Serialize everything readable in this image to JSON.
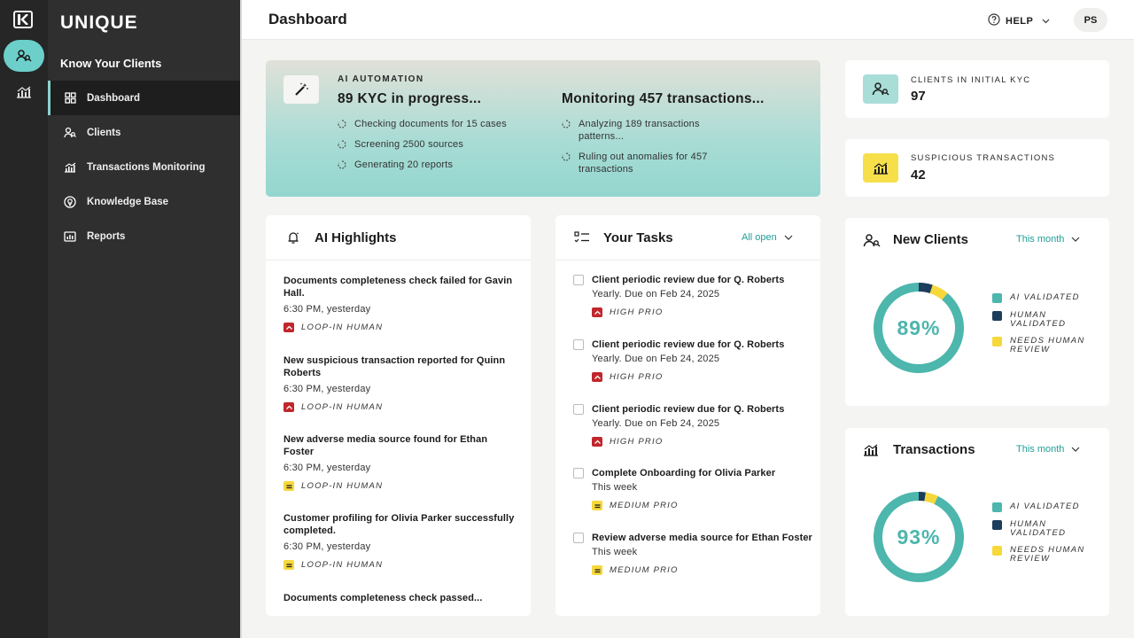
{
  "app": {
    "brand": "UNIQUE",
    "section": "Know Your Clients"
  },
  "sidebar": {
    "items": [
      {
        "label": "Dashboard",
        "icon": "dashboard-icon",
        "active": true
      },
      {
        "label": "Clients",
        "icon": "clients-icon"
      },
      {
        "label": "Transactions Monitoring",
        "icon": "transactions-icon"
      },
      {
        "label": "Knowledge Base",
        "icon": "knowledge-icon"
      },
      {
        "label": "Reports",
        "icon": "reports-icon"
      }
    ]
  },
  "header": {
    "title": "Dashboard",
    "help": "HELP",
    "avatar": "PS"
  },
  "automation": {
    "kicker": "AI AUTOMATION",
    "kyc_title": "89 KYC in progress...",
    "kyc_items": [
      "Checking documents for 15 cases",
      "Screening 2500 sources",
      "Generating 20 reports"
    ],
    "tx_title": "Monitoring 457 transactions...",
    "tx_items": [
      "Analyzing 189 transactions patterns...",
      "Ruling out anomalies for 457 transactions"
    ]
  },
  "stats": {
    "initial_kyc": {
      "label": "CLIENTS IN INITIAL KYC",
      "value": "97"
    },
    "suspicious": {
      "label": "SUSPICIOUS TRANSACTIONS",
      "value": "42"
    }
  },
  "highlights": {
    "title": "AI Highlights",
    "items": [
      {
        "text": "Documents completeness check failed for Gavin Hall.",
        "time": "6:30 PM, yesterday",
        "tag": "LOOP-IN HUMAN",
        "level": "high"
      },
      {
        "text": "New suspicious transaction reported for Quinn Roberts",
        "time": "6:30 PM, yesterday",
        "tag": "LOOP-IN HUMAN",
        "level": "high"
      },
      {
        "text": "New adverse media source found for Ethan Foster",
        "time": "6:30 PM, yesterday",
        "tag": "LOOP-IN HUMAN",
        "level": "medium"
      },
      {
        "text": "Customer profiling for Olivia Parker successfully completed.",
        "time": "6:30 PM, yesterday",
        "tag": "LOOP-IN HUMAN",
        "level": "medium"
      },
      {
        "text": "Documents completeness check passed..."
      }
    ]
  },
  "tasks": {
    "title": "Your Tasks",
    "filter": "All open",
    "items": [
      {
        "title": "Client periodic review due for Q. Roberts",
        "sub": "Yearly. Due on Feb 24, 2025",
        "tag": "HIGH PRIO",
        "level": "high"
      },
      {
        "title": "Client periodic review due for Q. Roberts",
        "sub": "Yearly. Due on Feb 24, 2025",
        "tag": "HIGH PRIO",
        "level": "high"
      },
      {
        "title": "Client periodic review due for Q. Roberts",
        "sub": "Yearly. Due on Feb 24, 2025",
        "tag": "HIGH PRIO",
        "level": "high"
      },
      {
        "title": "Complete Onboarding for Olivia Parker",
        "sub": "This week",
        "tag": "MEDIUM PRIO",
        "level": "medium"
      },
      {
        "title": "Review adverse media source for Ethan Foster",
        "sub": "This week",
        "tag": "MEDIUM PRIO",
        "level": "medium"
      }
    ]
  },
  "new_clients": {
    "title": "New Clients",
    "filter": "This month",
    "center": "89%",
    "segments": [
      0.89,
      0.05,
      0.06
    ],
    "legend": [
      "AI VALIDATED",
      "HUMAN VALIDATED",
      "NEEDS HUMAN REVIEW"
    ]
  },
  "transactions": {
    "title": "Transactions",
    "filter": "This month",
    "center": "93%",
    "segments": [
      0.93,
      0.025,
      0.045
    ],
    "legend": [
      "AI VALIDATED",
      "HUMAN VALIDATED",
      "NEEDS HUMAN REVIEW"
    ]
  },
  "colors": {
    "teal": "#4db6ad",
    "navy": "#1d3d5c",
    "yellow": "#f6d83a",
    "red": "#c0272d",
    "accent": "#1f9e97"
  }
}
